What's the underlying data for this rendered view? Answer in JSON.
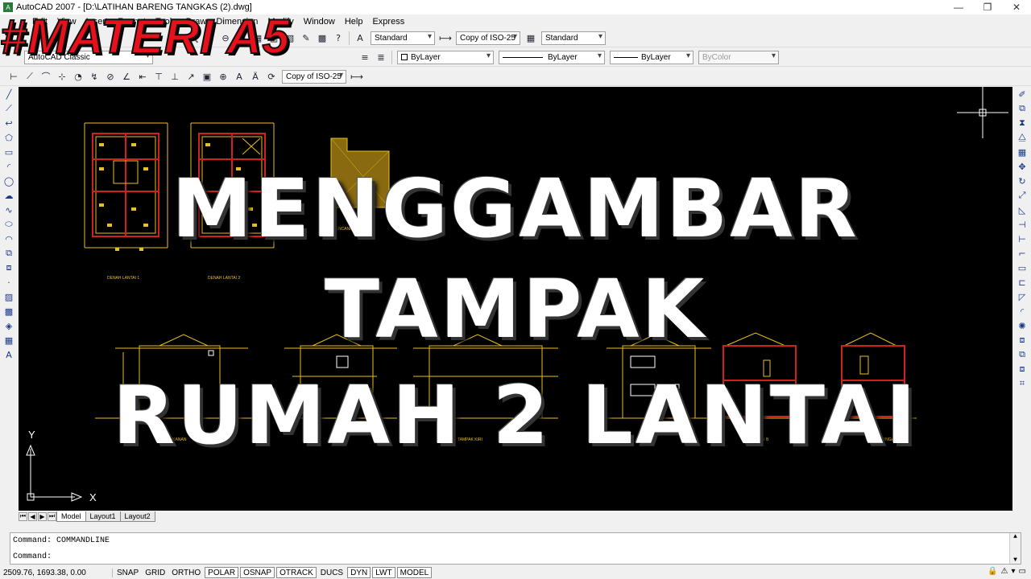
{
  "window": {
    "title": "AutoCAD 2007 - [D:\\LATIHAN BARENG TANGKAS (2).dwg]",
    "controls": [
      "—",
      "❐",
      "✕"
    ]
  },
  "menubar": [
    "Edit",
    "View",
    "Insert",
    "Format",
    "Tools",
    "Draw",
    "Dimension",
    "Modify",
    "Window",
    "Help",
    "Express"
  ],
  "toolbar": {
    "text_style": "Standard",
    "dim_style": "Copy of ISO-25",
    "table_style": "Standard",
    "workspace": "AutoCAD Classic",
    "color": "ByLayer",
    "linetype": "ByLayer",
    "lineweight": "ByLayer",
    "plotstyle": "ByColor",
    "dim_style_2": "Copy of ISO-25"
  },
  "tabs": [
    "Model",
    "Layout1",
    "Layout2"
  ],
  "command": {
    "line1": "Command: COMMANDLINE",
    "line2": "Command:"
  },
  "status": {
    "coords": "2509.76, 1693.38, 0.00",
    "buttons": [
      "SNAP",
      "GRID",
      "ORTHO",
      "POLAR",
      "OSNAP",
      "OTRACK",
      "DUCS",
      "DYN",
      "LWT",
      "MODEL"
    ]
  },
  "drawing_labels": {
    "plan1": "DENAH LANTAI 1",
    "plan2": "DENAH LANTAI 2",
    "roof": "RENCANA ATAP",
    "elev1": "TAMPAK KANAN",
    "elev2": "TAMPAK KIRI",
    "sec1": "POTONGAN B",
    "sec2": "POTONGAN A"
  },
  "ucs": {
    "x": "X",
    "y": "Y"
  },
  "overlay": {
    "banner": "#MATERI A5",
    "line1": "MENGGAMBAR",
    "line2": "TAMPAK",
    "line3": "RUMAH 2 LANTAI"
  },
  "colors": {
    "canvas": "#000000",
    "drawing_yellow": "#e8c020",
    "drawing_red": "#d02020",
    "banner_red": "#e8101a"
  }
}
